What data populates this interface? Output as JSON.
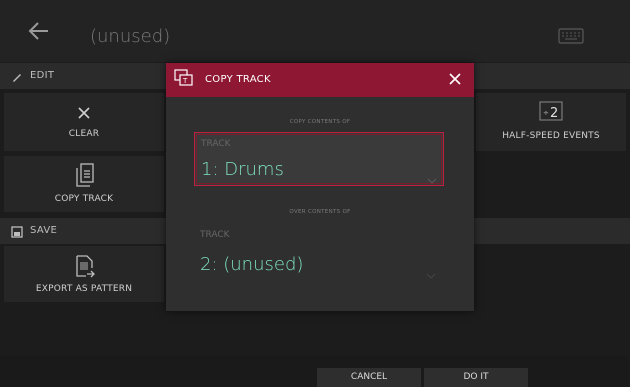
{
  "header": {
    "title": "(unused)",
    "back_icon": "back-arrow-icon",
    "keyboard_icon": "keyboard-icon"
  },
  "sections": {
    "edit": {
      "label": "EDIT",
      "icon": "pencil-icon"
    },
    "save": {
      "label": "SAVE",
      "icon": "floppy-disk-icon"
    }
  },
  "tiles": {
    "clear": {
      "label": "CLEAR",
      "icon": "x-icon"
    },
    "copy_track": {
      "label": "COPY TRACK",
      "icon": "copy-icon"
    },
    "half_speed": {
      "label": "HALF-SPEED EVENTS",
      "icon": "divide-by-two-icon"
    },
    "export_pattern": {
      "label": "EXPORT AS PATTERN",
      "icon": "export-pattern-icon"
    }
  },
  "dialog": {
    "title": "COPY TRACK",
    "title_icon": "copy-track-icon",
    "close_icon": "close-icon",
    "source_caption": "COPY CONTENTS OF",
    "source_field_label": "TRACK",
    "source_value": "1: Drums",
    "dest_caption": "OVER CONTENTS OF",
    "dest_field_label": "TRACK",
    "dest_value": "2: (unused)"
  },
  "footer": {
    "cancel_label": "CANCEL",
    "do_it_label": "DO IT"
  },
  "colors": {
    "accent_red": "#8e1834",
    "value_green": "#7fe3c2",
    "background": "#1c1c1c"
  }
}
